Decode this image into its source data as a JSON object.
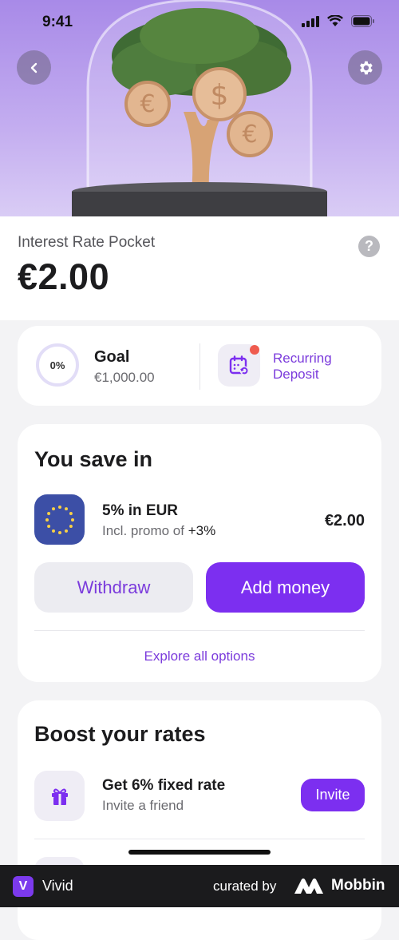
{
  "status_bar": {
    "time": "9:41"
  },
  "header": {
    "back_icon": "chevron-left-icon",
    "settings_icon": "gear-icon"
  },
  "pocket": {
    "title": "Interest Rate Pocket",
    "amount": "€2.00",
    "help_icon": "?"
  },
  "goal": {
    "progress": "0%",
    "label": "Goal",
    "target": "€1,000.00"
  },
  "recurring": {
    "label": "Recurring Deposit"
  },
  "save": {
    "title": "You save in",
    "rate_title": "5% in EUR",
    "rate_sub": "Incl. promo of ",
    "rate_promo": "+3%",
    "amount": "€2.00",
    "withdraw_label": "Withdraw",
    "add_money_label": "Add money",
    "explore_label": "Explore all options"
  },
  "boost": {
    "title": "Boost your rates",
    "row_title": "Get 6% fixed rate",
    "row_sub": "Invite a friend",
    "invite_label": "Invite"
  },
  "footer": {
    "logo_letter": "V",
    "app_name": "Vivid",
    "curated_by": "curated by",
    "brand": "Mobbin"
  },
  "colors": {
    "accent": "#7c2ff0",
    "accent_text": "#7b3bdc",
    "hero_bg": "#b39bec",
    "notification_dot": "#ef5b4f"
  }
}
